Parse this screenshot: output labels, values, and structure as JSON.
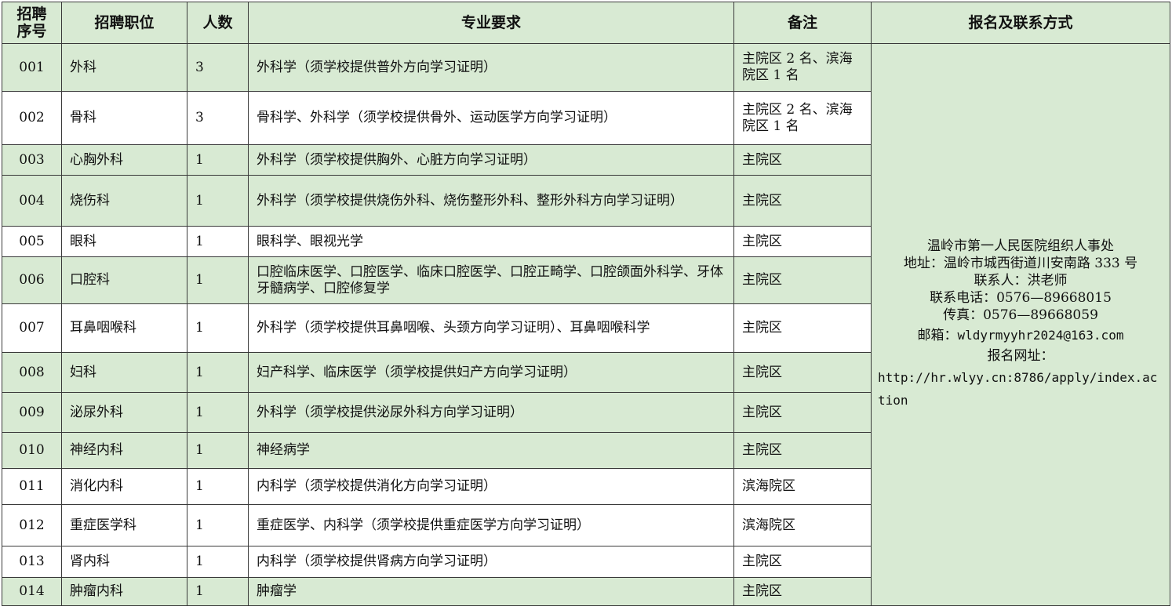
{
  "headers": {
    "seq_line1": "招聘",
    "seq_line2": "序号",
    "position": "招聘职位",
    "count": "人数",
    "major": "专业要求",
    "note": "备注",
    "contact": "报名及联系方式"
  },
  "rows": [
    {
      "seq": "001",
      "position": "外科",
      "count": "3",
      "major": "外科学（须学校提供普外方向学习证明）",
      "note": "主院区 2 名、滨海院区 1 名"
    },
    {
      "seq": "002",
      "position": "骨科",
      "count": "3",
      "major": "骨科学、外科学（须学校提供骨外、运动医学方向学习证明）",
      "note": "主院区 2 名、滨海院区 1 名"
    },
    {
      "seq": "003",
      "position": "心胸外科",
      "count": "1",
      "major": "外科学（须学校提供胸外、心脏方向学习证明）",
      "note": "主院区"
    },
    {
      "seq": "004",
      "position": "烧伤科",
      "count": "1",
      "major": "外科学（须学校提供烧伤外科、烧伤整形外科、整形外科方向学习证明）",
      "note": "主院区"
    },
    {
      "seq": "005",
      "position": "眼科",
      "count": "1",
      "major": "眼科学、眼视光学",
      "note": "主院区"
    },
    {
      "seq": "006",
      "position": "口腔科",
      "count": "1",
      "major": "口腔临床医学、口腔医学、临床口腔医学、口腔正畸学、口腔颌面外科学、牙体牙髓病学、口腔修复学",
      "note": "主院区"
    },
    {
      "seq": "007",
      "position": "耳鼻咽喉科",
      "count": "1",
      "major": "外科学（须学校提供耳鼻咽喉、头颈方向学习证明）、耳鼻咽喉科学",
      "note": "主院区"
    },
    {
      "seq": "008",
      "position": "妇科",
      "count": "1",
      "major": "妇产科学、临床医学（须学校提供妇产方向学习证明）",
      "note": "主院区"
    },
    {
      "seq": "009",
      "position": "泌尿外科",
      "count": "1",
      "major": "外科学（须学校提供泌尿外科方向学习证明）",
      "note": "主院区"
    },
    {
      "seq": "010",
      "position": "神经内科",
      "count": "1",
      "major": "神经病学",
      "note": "主院区"
    },
    {
      "seq": "011",
      "position": "消化内科",
      "count": "1",
      "major": "内科学（须学校提供消化方向学习证明）",
      "note": "滨海院区"
    },
    {
      "seq": "012",
      "position": "重症医学科",
      "count": "1",
      "major": "重症医学、内科学（须学校提供重症医学方向学习证明）",
      "note": "滨海院区"
    },
    {
      "seq": "013",
      "position": "肾内科",
      "count": "1",
      "major": "内科学（须学校提供肾病方向学习证明）",
      "note": "主院区"
    },
    {
      "seq": "014",
      "position": "肿瘤内科",
      "count": "1",
      "major": "肿瘤学",
      "note": "主院区"
    }
  ],
  "contact": {
    "org": "温岭市第一人民医院组织人事处",
    "address": "地址：温岭市城西街道川安南路 333 号",
    "person": "联系人：洪老师",
    "phone": "联系电话：0576—89668015",
    "fax": "传真：0576—89668059",
    "email_label": "邮箱：",
    "email": "wldyrmyyhr2024@163.com",
    "url_label": "报名网址：",
    "url": "http://hr.wlyy.cn:8786/apply/index.action"
  }
}
